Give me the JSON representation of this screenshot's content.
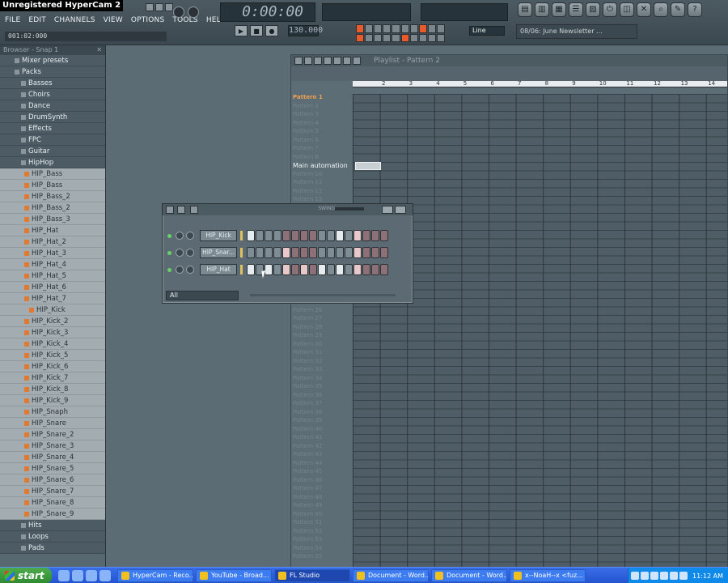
{
  "app": {
    "hypercam_label": "Unregistered HyperCam 2",
    "hint_bar": "001:02:000",
    "time_display": "0:00:00",
    "tempo": "130.000",
    "snap_mode": "Line",
    "news_ticker": "08/06: June Newsletter ..."
  },
  "menu": [
    "FILE",
    "EDIT",
    "CHANNELS",
    "VIEW",
    "OPTIONS",
    "TOOLS",
    "HELP"
  ],
  "browser": {
    "title": "Browser - Snap 1",
    "items": [
      {
        "label": "Mixer presets",
        "type": "folder"
      },
      {
        "label": "Packs",
        "type": "folder"
      },
      {
        "label": "Basses",
        "type": "folder"
      },
      {
        "label": "Choirs",
        "type": "folder"
      },
      {
        "label": "Dance",
        "type": "folder"
      },
      {
        "label": "DrumSynth",
        "type": "folder"
      },
      {
        "label": "Effects",
        "type": "folder"
      },
      {
        "label": "FPC",
        "type": "folder"
      },
      {
        "label": "Guitar",
        "type": "folder"
      },
      {
        "label": "HipHop",
        "type": "folder"
      },
      {
        "label": "HIP_Bass",
        "type": "file"
      },
      {
        "label": "HIP_Bass",
        "type": "file"
      },
      {
        "label": "HIP_Bass_2",
        "type": "file"
      },
      {
        "label": "HIP_Bass_2",
        "type": "file"
      },
      {
        "label": "HIP_Bass_3",
        "type": "file"
      },
      {
        "label": "HIP_Hat",
        "type": "file"
      },
      {
        "label": "HIP_Hat_2",
        "type": "file"
      },
      {
        "label": "HIP_Hat_3",
        "type": "file"
      },
      {
        "label": "HIP_Hat_4",
        "type": "file"
      },
      {
        "label": "HIP_Hat_5",
        "type": "file"
      },
      {
        "label": "HIP_Hat_6",
        "type": "file"
      },
      {
        "label": "HIP_Hat_7",
        "type": "file"
      },
      {
        "label": "HIP_Kick",
        "type": "file"
      },
      {
        "label": "HIP_Kick_2",
        "type": "file"
      },
      {
        "label": "HIP_Kick_3",
        "type": "file"
      },
      {
        "label": "HIP_Kick_4",
        "type": "file"
      },
      {
        "label": "HIP_Kick_5",
        "type": "file"
      },
      {
        "label": "HIP_Kick_6",
        "type": "file"
      },
      {
        "label": "HIP_Kick_7",
        "type": "file"
      },
      {
        "label": "HIP_Kick_8",
        "type": "file"
      },
      {
        "label": "HIP_Kick_9",
        "type": "file"
      },
      {
        "label": "HIP_Snaph",
        "type": "file"
      },
      {
        "label": "HIP_Snare",
        "type": "file"
      },
      {
        "label": "HIP_Snare_2",
        "type": "file"
      },
      {
        "label": "HIP_Snare_3",
        "type": "file"
      },
      {
        "label": "HIP_Snare_4",
        "type": "file"
      },
      {
        "label": "HIP_Snare_5",
        "type": "file"
      },
      {
        "label": "HIP_Snare_6",
        "type": "file"
      },
      {
        "label": "HIP_Snare_7",
        "type": "file"
      },
      {
        "label": "HIP_Snare_8",
        "type": "file"
      },
      {
        "label": "HIP_Snare_9",
        "type": "file"
      },
      {
        "label": "Hits",
        "type": "folder"
      },
      {
        "label": "Loops",
        "type": "folder"
      },
      {
        "label": "Pads",
        "type": "folder"
      }
    ]
  },
  "playlist": {
    "title": "Playlist - Pattern 2",
    "ruler": [
      "2",
      "3",
      "4",
      "5",
      "6",
      "7",
      "8",
      "9",
      "10",
      "11",
      "12",
      "13",
      "14"
    ],
    "rows_top": [
      "Pattern 1",
      "Pattern 2",
      "Pattern 3",
      "Pattern 4",
      "Pattern 5",
      "Pattern 6",
      "Pattern 7",
      "Pattern 8",
      "Main automation",
      "Pattern 10",
      "Pattern 11",
      "Pattern 12",
      "Pattern 13"
    ],
    "rows_bottom": [
      "Pattern 26",
      "Pattern 27",
      "Pattern 28",
      "Pattern 29",
      "Pattern 30",
      "Pattern 31",
      "Pattern 32",
      "Pattern 33",
      "Pattern 34",
      "Pattern 35",
      "Pattern 36",
      "Pattern 37",
      "Pattern 38",
      "Pattern 39",
      "Pattern 40",
      "Pattern 41",
      "Pattern 42",
      "Pattern 43",
      "Pattern 44",
      "Pattern 45",
      "Pattern 46",
      "Pattern 47",
      "Pattern 48",
      "Pattern 49",
      "Pattern 50",
      "Pattern 51",
      "Pattern 52",
      "Pattern 53",
      "Pattern 54",
      "Pattern 55"
    ]
  },
  "stepseq": {
    "swing_label": "SWING",
    "filter": "All",
    "channels": [
      {
        "name": "HIP_Kick",
        "steps": [
          1,
          0,
          0,
          0,
          0,
          0,
          0,
          0,
          0,
          0,
          1,
          0,
          1,
          0,
          0,
          0
        ]
      },
      {
        "name": "HIP_Snar...",
        "steps": [
          0,
          0,
          0,
          0,
          1,
          0,
          0,
          0,
          0,
          0,
          0,
          0,
          1,
          0,
          0,
          0
        ]
      },
      {
        "name": "HIP_Hat",
        "steps": [
          1,
          0,
          1,
          0,
          1,
          0,
          1,
          0,
          1,
          0,
          1,
          0,
          1,
          0,
          0,
          0
        ]
      }
    ]
  },
  "taskbar": {
    "start": "start",
    "tasks": [
      "HyperCam - Reco...",
      "YouTube - Broad...",
      "FL Studio",
      "Document - Word...",
      "Document - Word...",
      "x--NoaH--x <fuz..."
    ],
    "clock": "11:12 AM"
  }
}
